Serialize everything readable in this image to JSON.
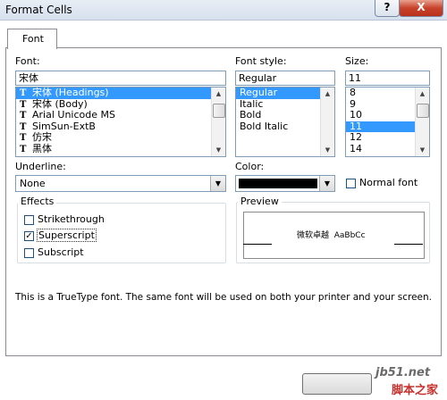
{
  "window": {
    "title": "Format Cells",
    "help_glyph": "?",
    "close_glyph": "X"
  },
  "tabs": [
    {
      "label": "Font"
    }
  ],
  "font": {
    "label": "Font:",
    "value": "宋体",
    "items": [
      {
        "label": "宋体 (Headings)",
        "tt": "T",
        "selected": true
      },
      {
        "label": "宋体 (Body)",
        "tt": "T"
      },
      {
        "label": "Arial Unicode MS",
        "tt": "T"
      },
      {
        "label": "SimSun-ExtB",
        "tt": "T"
      },
      {
        "label": "仿宋",
        "tt": "T"
      },
      {
        "label": "黑体",
        "tt": "T"
      }
    ]
  },
  "font_style": {
    "label": "Font style:",
    "value": "Regular",
    "items": [
      {
        "label": "Regular",
        "selected": true
      },
      {
        "label": "Italic"
      },
      {
        "label": "Bold"
      },
      {
        "label": "Bold Italic"
      }
    ]
  },
  "size": {
    "label": "Size:",
    "value": "11",
    "items": [
      {
        "label": "8"
      },
      {
        "label": "9"
      },
      {
        "label": "10"
      },
      {
        "label": "11",
        "selected": true
      },
      {
        "label": "12"
      },
      {
        "label": "14"
      }
    ]
  },
  "underline": {
    "label": "Underline:",
    "value": "None"
  },
  "color": {
    "label": "Color:",
    "swatch": "#000000"
  },
  "normal_font": {
    "label": "Normal font",
    "checked": false
  },
  "effects": {
    "label": "Effects",
    "items": [
      {
        "label": "Strikethrough",
        "checked": false
      },
      {
        "label": "Superscript",
        "checked": true
      },
      {
        "label": "Subscript",
        "checked": false
      }
    ]
  },
  "preview": {
    "label": "Preview",
    "sample": "微软卓越  AaBbCc"
  },
  "info_text": "This is a TrueType font.  The same font will be used on both your printer and your screen.",
  "watermark": {
    "line1": "jb51.net",
    "line2": "脚本之家"
  },
  "colors": {
    "selection": "#3399ff",
    "border": "#7f9db9"
  }
}
